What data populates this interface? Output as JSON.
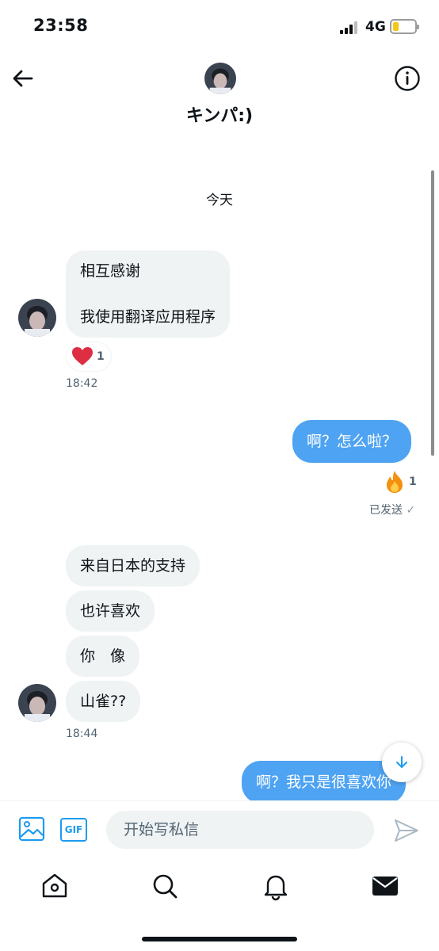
{
  "status_bar": {
    "time": "23:58",
    "network": "4G",
    "battery_level": 0.25
  },
  "header": {
    "title": "キンパ:)",
    "back_icon": "arrow-left-icon",
    "info_icon": "info-icon"
  },
  "conversation": {
    "day_label": "今天",
    "group1": {
      "lines": [
        "相互感谢",
        "我使用翻译应用程序"
      ],
      "reaction_count": "1",
      "time": "18:42"
    },
    "sent1": {
      "text": "啊？怎么啦？",
      "reaction_count": "1",
      "status": "已发送"
    },
    "group2": {
      "messages": [
        "来自日本的支持",
        "也许喜欢",
        "你　像",
        "山雀??"
      ],
      "time": "18:44"
    },
    "sent2": {
      "text": "啊？我只是很喜欢你"
    }
  },
  "composer": {
    "placeholder": "开始写私信",
    "gif_label": "GIF"
  },
  "colors": {
    "accent": "#1d9bf0",
    "sent_bubble": "#4ea3f2",
    "received_bubble": "#eff3f4"
  }
}
